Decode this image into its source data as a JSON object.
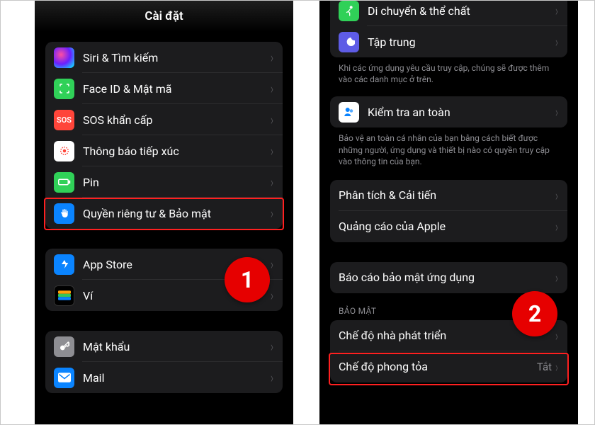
{
  "left": {
    "title": "Cài đặt",
    "rows": {
      "siri": "Siri & Tìm kiếm",
      "faceid": "Face ID & Mật mã",
      "sos": "SOS khẩn cấp",
      "expose": "Thông báo tiếp xúc",
      "battery": "Pin",
      "privacy": "Quyền riêng tư & Bảo mật",
      "appstore": "App Store",
      "wallet": "Ví",
      "passwords": "Mật khẩu",
      "mail": "Mail"
    },
    "step_label": "1"
  },
  "right": {
    "rows": {
      "fitness": "Di chuyển & thể chất",
      "focus": "Tập trung",
      "safety": "Kiểm tra an toàn",
      "analytics": "Phân tích & Cải tiến",
      "ads": "Quảng cáo của Apple",
      "privacyreport": "Báo cáo bảo mật ứng dụng",
      "devmode": "Chế độ nhà phát triển",
      "lockdown": "Chế độ phong tỏa"
    },
    "footer_access": "Khi các ứng dụng yêu cầu truy cập, chúng sẽ được thêm vào các danh mục ở trên.",
    "footer_safety": "Bảo vệ an toàn cá nhân của bạn bằng cách biết được những người, ứng dụng và thiết bị nào có quyền truy cập vào thông tin của bạn.",
    "section_security": "BẢO MẬT",
    "lockdown_value": "Tắt",
    "step_label": "2"
  },
  "colors": {
    "green": "#30d158",
    "blue": "#0a84ff",
    "red": "#ff453a",
    "white": "#ffffff",
    "gray": "#8e8e93",
    "orange": "#ff9f0a",
    "purple": "#5e5ce6"
  }
}
